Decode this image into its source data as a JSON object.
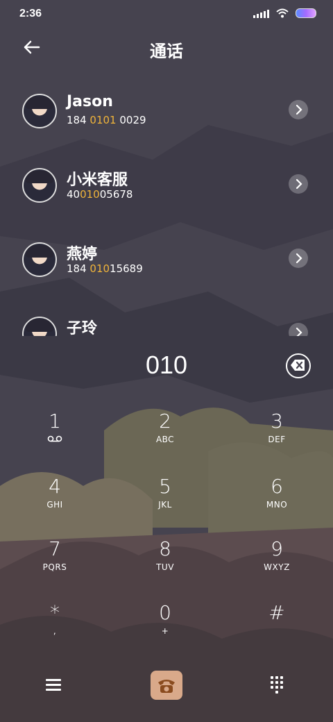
{
  "status_bar": {
    "time": "2:36"
  },
  "header": {
    "title": "通话"
  },
  "contacts": [
    {
      "name": "Jason",
      "number_pre": "184 ",
      "number_hl": "0101",
      "number_post": " 0029"
    },
    {
      "name": "小米客服",
      "number_pre": "40",
      "number_hl": "010",
      "number_post": "05678"
    },
    {
      "name": "燕婷",
      "number_pre": "184 ",
      "number_hl": "010",
      "number_post": "15689"
    },
    {
      "name": "子玲",
      "number_pre": "",
      "number_hl": "",
      "number_post": ""
    }
  ],
  "dialer": {
    "value": "010"
  },
  "keypad": [
    {
      "digit": "1",
      "letters": ""
    },
    {
      "digit": "2",
      "letters": "ABC"
    },
    {
      "digit": "3",
      "letters": "DEF"
    },
    {
      "digit": "4",
      "letters": "GHI"
    },
    {
      "digit": "5",
      "letters": "JKL"
    },
    {
      "digit": "6",
      "letters": "MNO"
    },
    {
      "digit": "7",
      "letters": "PQRS"
    },
    {
      "digit": "8",
      "letters": "TUV"
    },
    {
      "digit": "9",
      "letters": "WXYZ"
    },
    {
      "digit": "*",
      "letters": ","
    },
    {
      "digit": "0",
      "letters": "+"
    },
    {
      "digit": "#",
      "letters": ""
    }
  ],
  "icons": {
    "back": "arrow-left-icon",
    "chevron": "chevron-right-icon",
    "backspace": "backspace-icon",
    "voicemail": "voicemail-icon",
    "menu": "menu-icon",
    "call": "phone-icon",
    "keypad": "keypad-icon"
  },
  "colors": {
    "highlight": "#f0b43a",
    "call_button": "#d9a98a"
  }
}
